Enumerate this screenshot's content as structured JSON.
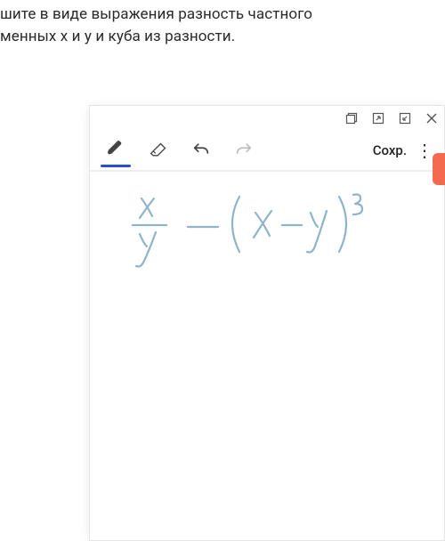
{
  "question": {
    "line1": "шите в виде выражения разность частного",
    "line2": "менных x и y и куба из разности."
  },
  "toolbar": {
    "save_label": "Сохр."
  },
  "handwriting": {
    "expression_tex": "\\frac{x}{y} - (x - y)^{3}",
    "expression_plain": "x/y − (x − y)^3"
  },
  "colors": {
    "pen_underline": "#2b4cd6",
    "ink": "#8fb4c9",
    "side_tab": "#f46a4e"
  }
}
